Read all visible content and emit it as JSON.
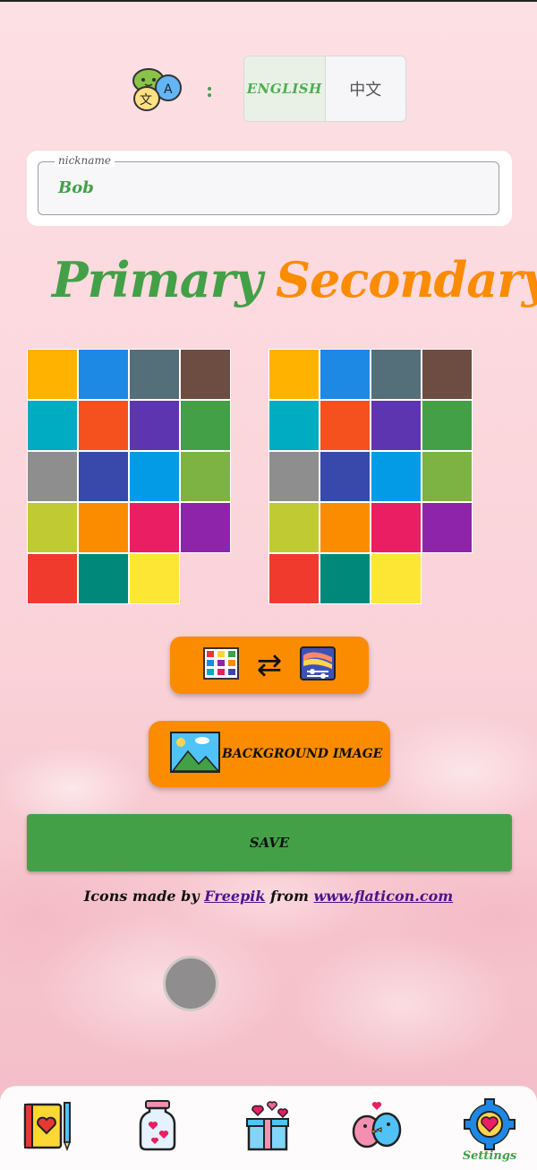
{
  "language": {
    "colon": ":",
    "options": [
      "ENGLISH",
      "中文"
    ],
    "selected": "ENGLISH"
  },
  "nickname": {
    "label": "nickname",
    "value": "Bob"
  },
  "headings": {
    "primary": "Primary",
    "secondary": "Secondary"
  },
  "palette_colors": [
    "#ffb300",
    "#1e88e5",
    "#546e7a",
    "#6d4c41",
    "#00acc1",
    "#f4511e",
    "#5e35b1",
    "#43a047",
    "#8e8e8e",
    "#3949ab",
    "#039be5",
    "#7cb342",
    "#c0ca33",
    "#fb8c00",
    "#e91e63",
    "#8e24aa",
    "#f03a2e",
    "#00897b",
    "#fde634"
  ],
  "buttons": {
    "swap_arrows": "⇄",
    "background_image": "BACKGROUND IMAGE",
    "save": "SAVE"
  },
  "credit": {
    "prefix": "Icons made by ",
    "author": "Freepik",
    "middle": " from ",
    "site": "www.flaticon.com"
  },
  "colors": {
    "accent_green": "#43a047",
    "accent_orange": "#fb8c00",
    "link_purple": "#4a148c"
  },
  "bottom_nav": {
    "items": [
      {
        "icon": "diary-book-icon",
        "label": ""
      },
      {
        "icon": "heart-jar-icon",
        "label": ""
      },
      {
        "icon": "gift-box-icon",
        "label": ""
      },
      {
        "icon": "love-birds-icon",
        "label": ""
      },
      {
        "icon": "settings-gear-icon",
        "label": "Settings"
      }
    ],
    "active": "Settings"
  }
}
